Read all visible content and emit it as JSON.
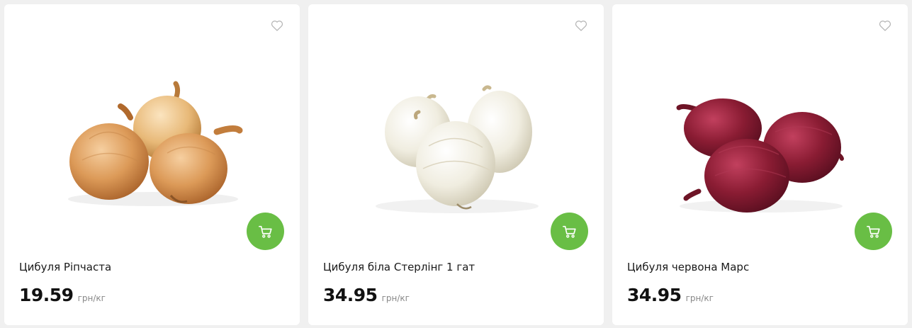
{
  "colors": {
    "page_background": "#f0f0f0",
    "card_background": "#ffffff",
    "cart_button": "#69be45",
    "heart_outline": "#b5b5b5"
  },
  "icons": {
    "favorite": "heart-outline-icon",
    "cart": "shopping-cart-icon"
  },
  "products": [
    {
      "name": "Цибуля Ріпчаста",
      "price": "19.59",
      "unit": "грн/кг",
      "image": "yellow-onions"
    },
    {
      "name": "Цибуля біла Стерлінг 1 гат",
      "price": "34.95",
      "unit": "грн/кг",
      "image": "white-onions"
    },
    {
      "name": "Цибуля червона Марс",
      "price": "34.95",
      "unit": "грн/кг",
      "image": "red-onions"
    }
  ]
}
